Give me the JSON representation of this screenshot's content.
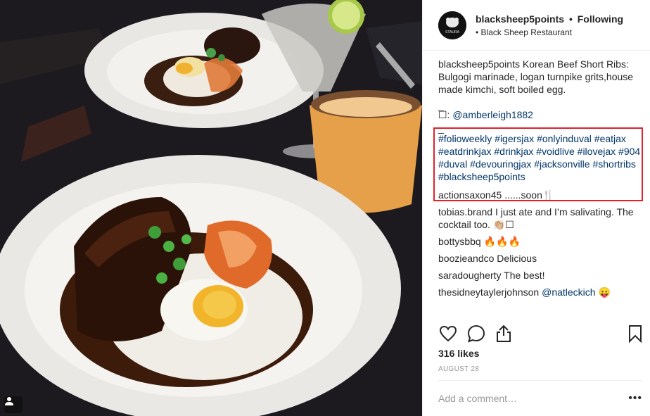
{
  "post": {
    "username": "blacksheep5points",
    "dot": "•",
    "follow_status": "Following",
    "location": "• Black Sheep Restaurant",
    "avatar_text": "STAURA"
  },
  "caption": {
    "username": "blacksheep5points",
    "text": "Korean Beef Short Ribs: Bulgogi marinade, logan turnpike grits,house made kimchi, soft boiled egg.",
    "sep1": "_",
    "camera_prefix": "☐:",
    "credit_mention": "@amberleigh1882",
    "sep2": "_",
    "hashtags": "#folioweekly #igersjax #onlyinduval #eatjax #eatdrinkjax #drinkjax #voidlive #ilovejax #904 #duval #devouringjax #jacksonville #shortribs #blacksheep5points"
  },
  "comments": [
    {
      "user": "actionsaxon45",
      "text": "......soon🍴"
    },
    {
      "user": "tobias.brand",
      "text": "I just ate and I’m salivating. The cocktail too. 👏🏼☐"
    },
    {
      "user": "bottysbbq",
      "text": "🔥🔥🔥"
    },
    {
      "user": "boozieandco",
      "text": "Delicious"
    },
    {
      "user": "saradougherty",
      "text": "The best!"
    },
    {
      "user": "thesidneytaylerjohnson",
      "mention": "@natleckich",
      "text": "😛"
    }
  ],
  "actions": {
    "like_icon": "heart-icon",
    "comment_icon": "comment-icon",
    "share_icon": "share-icon",
    "save_icon": "bookmark-icon"
  },
  "likes": "316 likes",
  "date": "AUGUST 28",
  "add_comment_placeholder": "Add a comment…",
  "more_label": "•••",
  "colors": {
    "link": "#003569",
    "highlight_box": "#e0222a",
    "muted": "#999999"
  }
}
